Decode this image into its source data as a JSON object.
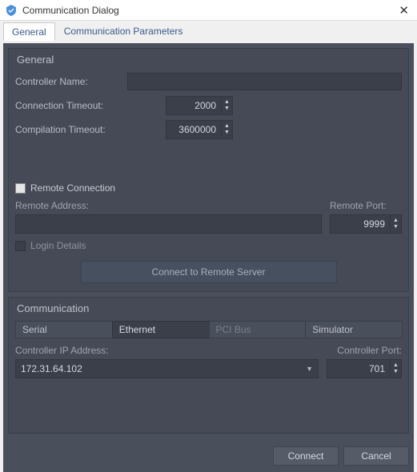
{
  "window": {
    "title": "Communication Dialog",
    "close_glyph": "✕"
  },
  "tabs": {
    "general": "General",
    "params": "Communication Parameters"
  },
  "general_group": {
    "legend": "General",
    "controller_name_label": "Controller Name:",
    "controller_name_value": "",
    "connection_timeout_label": "Connection Timeout:",
    "connection_timeout_value": "2000",
    "compilation_timeout_label": "Compilation Timeout:",
    "compilation_timeout_value": "3600000"
  },
  "remote": {
    "checkbox_label": "Remote Connection",
    "address_label": "Remote Address:",
    "address_value": "",
    "port_label": "Remote Port:",
    "port_value": "9999",
    "login_label": "Login Details",
    "connect_server_btn": "Connect to Remote Server"
  },
  "comm_group": {
    "legend": "Communication",
    "tabs": {
      "serial": "Serial",
      "ethernet": "Ethernet",
      "pcibus": "PCI Bus",
      "simulator": "Simulator"
    },
    "ip_label": "Controller IP Address:",
    "ip_value": "172.31.64.102",
    "port_label": "Controller Port:",
    "port_value": "701"
  },
  "footer": {
    "connect": "Connect",
    "cancel": "Cancel"
  },
  "spin_glyph_up": "▲",
  "spin_glyph_down": "▼",
  "caret_glyph": "▼"
}
